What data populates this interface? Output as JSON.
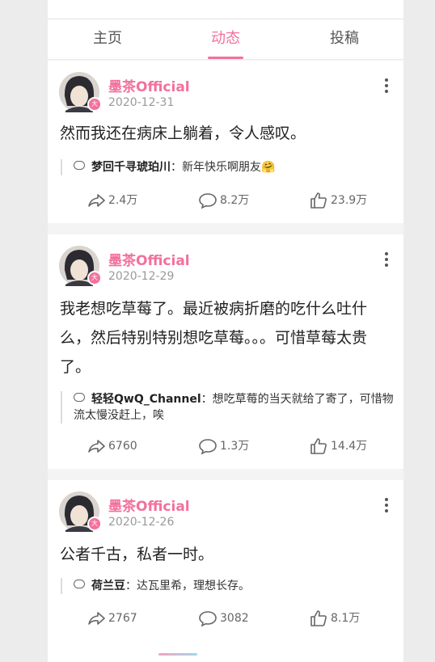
{
  "tabs": [
    {
      "label": "主页"
    },
    {
      "label": "动态"
    },
    {
      "label": "投稿"
    }
  ],
  "posts": [
    {
      "author": "墨茶Official",
      "date": "2020-12-31",
      "content": "然而我还在病床上躺着，令人感叹。",
      "comment": {
        "name": "梦回千寻琥珀川",
        "text": "新年快乐啊朋友🤗"
      },
      "shares": "2.4万",
      "comments": "8.2万",
      "likes": "23.9万"
    },
    {
      "author": "墨茶Official",
      "date": "2020-12-29",
      "content": "我老想吃草莓了。最近被病折磨的吃什么吐什么，然后特别特别想吃草莓。。。可惜草莓太贵了。",
      "comment": {
        "name": "轻轻QwQ_Channel",
        "text": "想吃草莓的当天就给了寄了，可惜物流太慢没赶上，唉"
      },
      "shares": "6760",
      "comments": "1.3万",
      "likes": "14.4万"
    },
    {
      "author": "墨茶Official",
      "date": "2020-12-26",
      "content": "公者千古，私者一时。",
      "comment": {
        "name": "荷兰豆",
        "text": "达瓦里希，理想长存。"
      },
      "shares": "2767",
      "comments": "3082",
      "likes": "8.1万"
    }
  ],
  "colors": {
    "accent": "#f2719c",
    "badge": "#f2719c"
  },
  "icons": [
    "share-icon",
    "comment-icon",
    "like-icon",
    "more-icon",
    "comment-bubble-icon"
  ]
}
